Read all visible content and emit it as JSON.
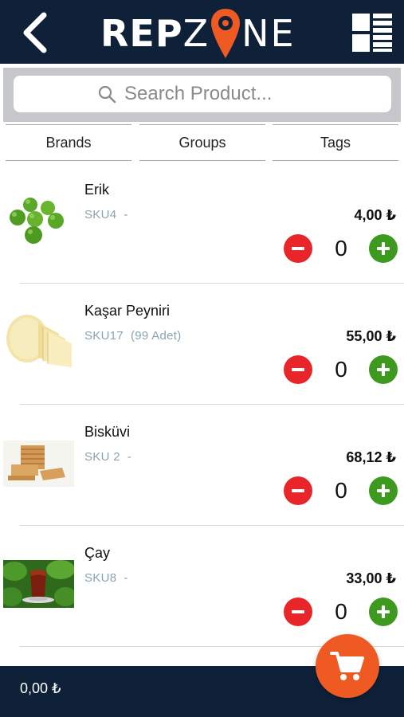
{
  "header": {
    "logo_left": "REP",
    "logo_z": "Z",
    "logo_right": "NE",
    "back_icon": "chevron-left-icon",
    "menu_icon": "grid-list-icon",
    "brand_orange": "#ee5a22",
    "bar_color": "#0e2139"
  },
  "search": {
    "placeholder": "Search Product...",
    "value": ""
  },
  "filters": [
    {
      "label": "Brands"
    },
    {
      "label": "Groups"
    },
    {
      "label": "Tags"
    }
  ],
  "products": [
    {
      "name": "Erik",
      "sku": "SKU4",
      "stock": "-",
      "price": "4,00 ₺",
      "qty": "0",
      "image": "green-plums"
    },
    {
      "name": "Kaşar Peyniri",
      "sku": "SKU17",
      "stock": "(99 Adet)",
      "price": "55,00 ₺",
      "qty": "0",
      "image": "cheese-wheel"
    },
    {
      "name": "Bisküvi",
      "sku": "SKU 2",
      "stock": "-",
      "price": "68,12 ₺",
      "qty": "0",
      "image": "biscuits"
    },
    {
      "name": "Çay",
      "sku": "SKU8",
      "stock": "-",
      "price": "33,00 ₺",
      "qty": "0",
      "image": "tea-glass"
    }
  ],
  "footer": {
    "total": "0,00 ₺",
    "cart_icon": "shopping-cart-icon"
  },
  "colors": {
    "minus": "#e8262a",
    "plus": "#3e9a1f",
    "sku_text": "#8aa3b3"
  }
}
